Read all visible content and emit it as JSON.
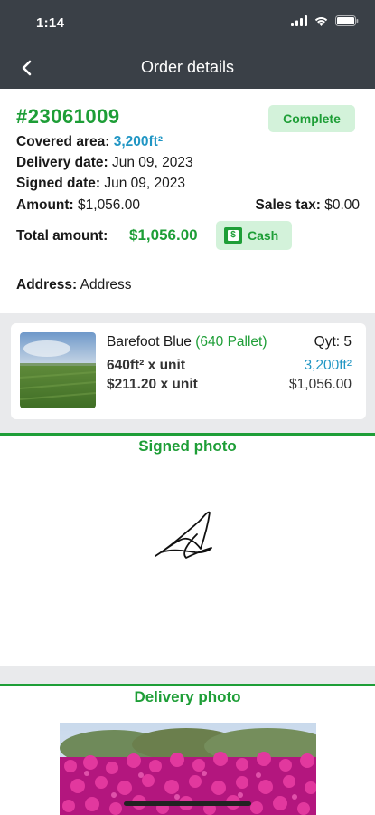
{
  "status_bar": {
    "time": "1:14"
  },
  "nav": {
    "title": "Order details"
  },
  "order": {
    "number": "#23061009",
    "status": "Complete",
    "covered_area_label": "Covered area:",
    "covered_area_value": "3,200ft²",
    "delivery_date_label": "Delivery date:",
    "delivery_date_value": "Jun 09, 2023",
    "signed_date_label": "Signed date:",
    "signed_date_value": "Jun 09, 2023",
    "amount_label": "Amount:",
    "amount_value": "$1,056.00",
    "sales_tax_label": "Sales tax:",
    "sales_tax_value": "$0.00",
    "total_label": "Total amount:",
    "total_value": "$1,056.00",
    "payment_method": "Cash",
    "address_label": "Address:",
    "address_value": "Address"
  },
  "product": {
    "name": "Barefoot Blue",
    "pallet": "(640 Pallet)",
    "qty": "Qyt: 5",
    "unit_area": "640ft² x unit",
    "total_area": "3,200ft²",
    "unit_price": "$211.20 x unit",
    "total_price": "$1,056.00"
  },
  "sections": {
    "signed_photo": "Signed photo",
    "delivery_photo": "Delivery photo"
  },
  "colors": {
    "accent": "#1e9e37",
    "link_blue": "#2196c4",
    "header": "#3a4047"
  }
}
